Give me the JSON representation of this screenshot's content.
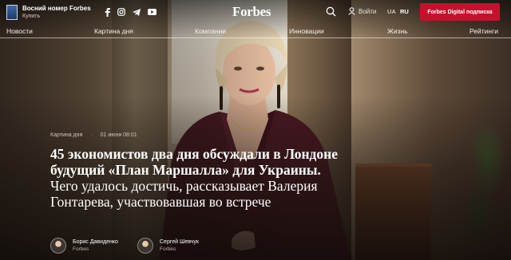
{
  "header": {
    "issue_title": "Восний номер Forbes",
    "issue_buy": "Купить",
    "logo": "Forbes",
    "login": "Войти",
    "lang_ua": "UA",
    "lang_ru": "RU",
    "subscribe": "Forbes Digital подписка",
    "social_icons": [
      "facebook-icon",
      "instagram-icon",
      "telegram-icon",
      "youtube-icon"
    ]
  },
  "nav": {
    "items": [
      "Новости",
      "Картина дня",
      "Компании",
      "Инновации",
      "Жизнь",
      "Рейтинги"
    ]
  },
  "article": {
    "category": "Картина дня",
    "date": "01 июня 08:01",
    "headline_bold": "45 экономистов два дня обсуждали в Лондоне будущий «План Маршалла» для Украины.",
    "headline_rest": " Чего удалось достичь, рассказывает Валерия Гонтарева, участвовавшая во встрече",
    "authors": [
      {
        "name": "Борис Давиденко",
        "org": "Forbes"
      },
      {
        "name": "Сергей Шевчук",
        "org": "Forbes"
      }
    ]
  },
  "colors": {
    "accent": "#c8102e",
    "text": "#ffffff"
  }
}
